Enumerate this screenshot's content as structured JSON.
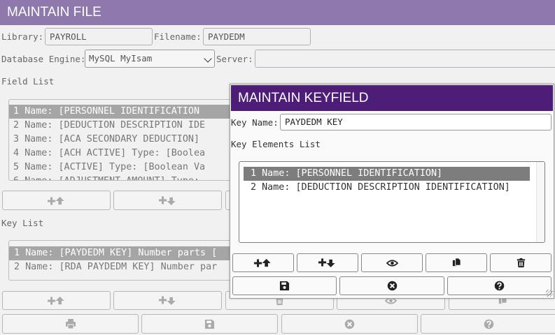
{
  "window": {
    "title": "MAINTAIN FILE"
  },
  "form": {
    "library_label": "Library:",
    "library_value": "PAYROLL",
    "filename_label": "Filename:",
    "filename_value": "PAYDEDM",
    "engine_label": "Database Engine:",
    "engine_value": "MySQL MyIsam",
    "server_label": "Server:",
    "server_value": ""
  },
  "field_list": {
    "label": "Field List",
    "items": [
      "1 Name: [PERSONNEL IDENTIFICATION",
      "2 Name: [DEDUCTION DESCRIPTION IDE",
      "3 Name: [ACA SECONDARY DEDUCTION]",
      "4 Name: [ACH ACTIVE] Type: [Boolea",
      "5 Name: [ACTIVE] Type: [Boolean Va",
      "6 Name: [ADJUSTMENT AMOUNT] Type:"
    ],
    "selected_index": 0
  },
  "key_list": {
    "label": "Key List",
    "items": [
      "1 Name: [PAYDEDM KEY] Number parts [",
      "2 Name: [RDA PAYDEDM KEY] Number par"
    ],
    "selected_index": 0
  },
  "icons": {
    "add_above": "add-above-icon",
    "add_below": "add-below-icon",
    "view": "eye-icon",
    "copy": "copy-icon",
    "delete": "trash-icon",
    "save": "save-icon",
    "cancel": "close-circle-icon",
    "help": "help-icon",
    "print": "print-icon"
  },
  "dialog": {
    "title": "MAINTAIN KEYFIELD",
    "key_name_label": "Key Name:",
    "key_name_value": "PAYDEDM KEY",
    "elements_label": "Key Elements List",
    "elements": [
      "1 Name: [PERSONNEL IDENTIFICATION]",
      "2 Name: [DEDUCTION DESCRIPTION IDENTIFICATION]"
    ],
    "selected_index": 0
  },
  "colors": {
    "main_title_bar": "#8e78ac",
    "dialog_title_bar": "#4e1d78",
    "selected_row": "#7d7d7d"
  }
}
